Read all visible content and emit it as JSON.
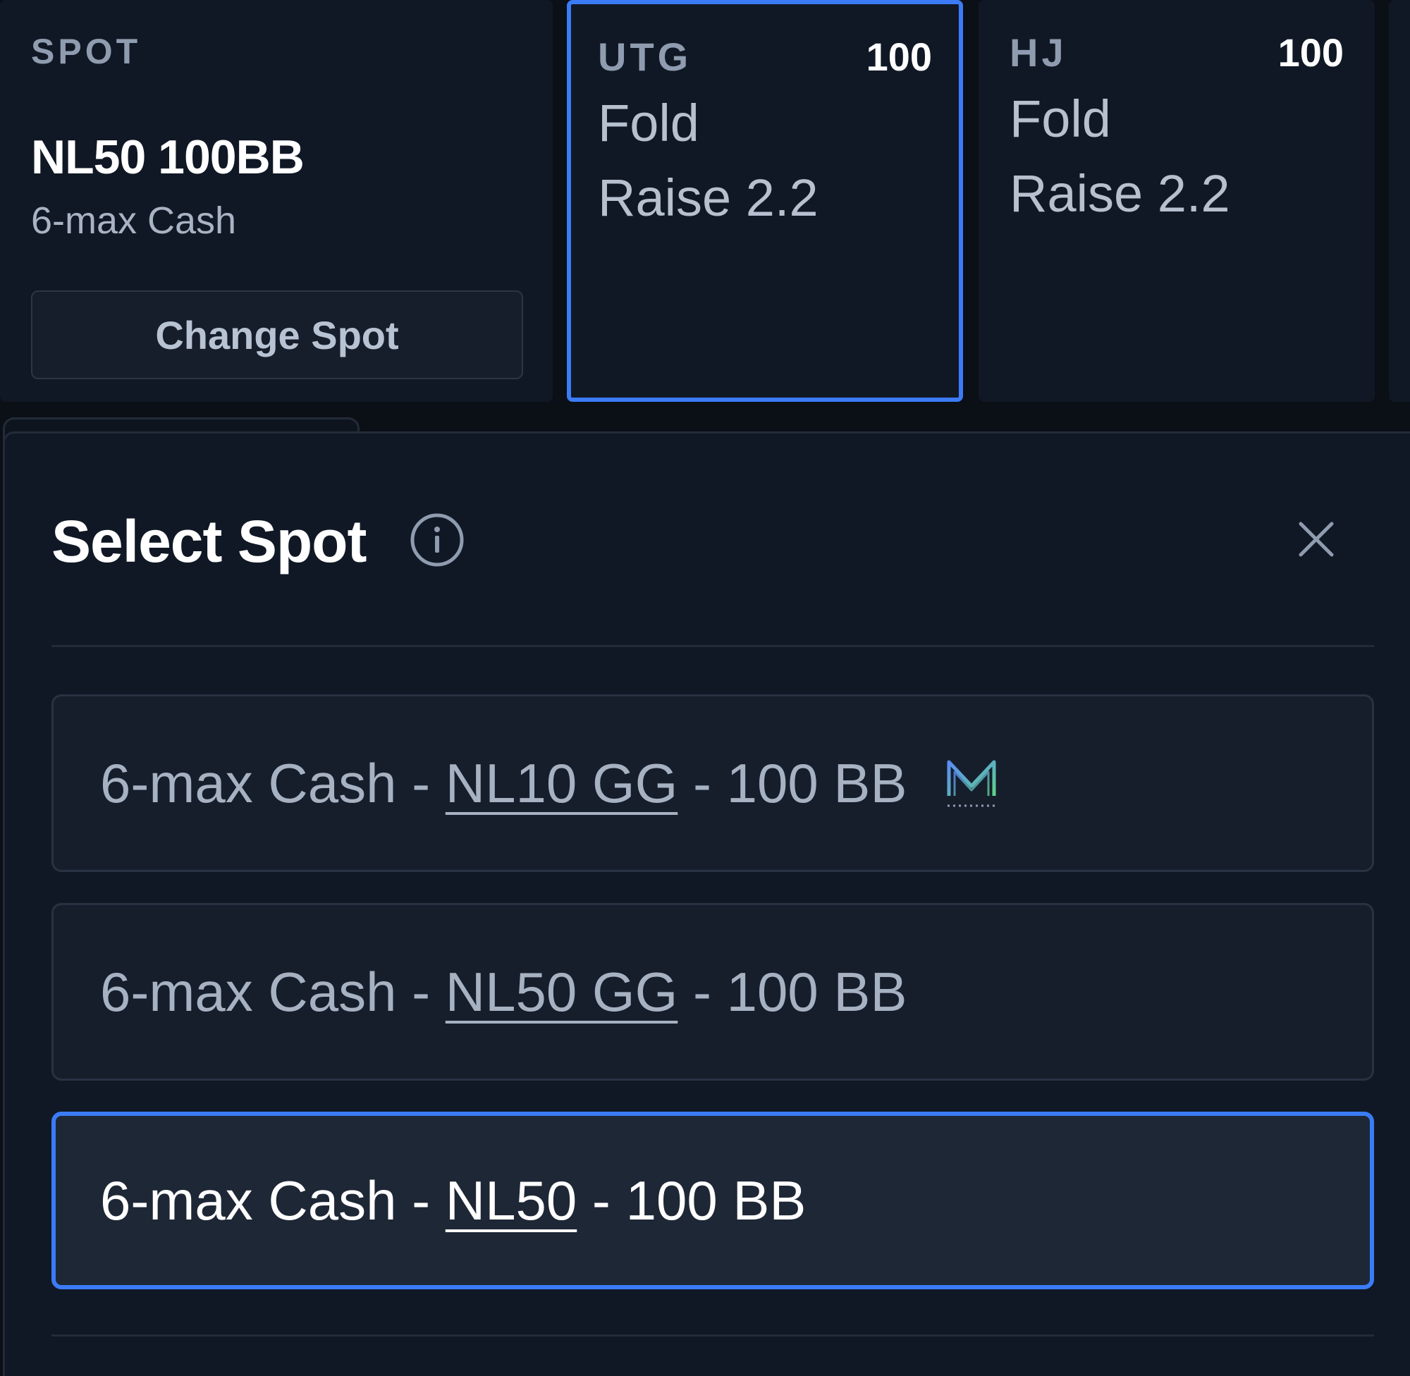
{
  "spot_panel": {
    "heading": "SPOT",
    "name": "NL50 100BB",
    "subtitle": "6-max Cash",
    "change_button_label": "Change Spot"
  },
  "seats": [
    {
      "position": "UTG",
      "stack": "100",
      "actions": [
        "Fold",
        "Raise 2.2"
      ],
      "selected": true
    },
    {
      "position": "HJ",
      "stack": "100",
      "actions": [
        "Fold",
        "Raise 2.2"
      ],
      "selected": false
    }
  ],
  "modal": {
    "title": "Select Spot",
    "options": [
      {
        "format": "6-max Cash",
        "sep1": " - ",
        "stake": "NL10 GG",
        "sep2": " - ",
        "depth": "100 BB",
        "badge_icon": "m-logo-icon",
        "selected": false
      },
      {
        "format": "6-max Cash",
        "sep1": " - ",
        "stake": "NL50 GG",
        "sep2": " - ",
        "depth": "100 BB",
        "selected": false
      },
      {
        "format": "6-max Cash",
        "sep1": " - ",
        "stake": "NL50",
        "sep2": " - ",
        "depth": "100 BB",
        "selected": true
      }
    ]
  },
  "colors": {
    "background": "#0b0f16",
    "panel": "#111825",
    "accent": "#3b7cf6",
    "muted_text": "#8f9cb0"
  },
  "icons": {
    "info": "info-icon",
    "close": "close-icon",
    "badge": "m-logo-icon"
  }
}
